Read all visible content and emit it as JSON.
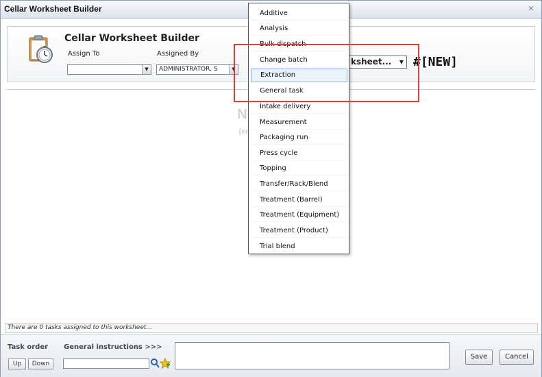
{
  "window": {
    "title": "Cellar Worksheet Builder"
  },
  "header": {
    "title": "Cellar Worksheet Builder",
    "assign_to_label": "Assign To",
    "assign_to_value": "",
    "assigned_by_label": "Assigned By",
    "assigned_by_value": "ADMINISTRATOR, S",
    "worksheet_select_value": "ksheet...",
    "new_label": "#[NEW]"
  },
  "main": {
    "empty_title": "NO TAS          ED",
    "empty_sub_line1": "(select from th                     click",
    "empty_sub_line2": "'Save' to"
  },
  "status": {
    "text": "There are 0 tasks assigned to this worksheet..."
  },
  "footer": {
    "task_order_label": "Task order",
    "general_instructions_label": "General instructions >>>",
    "up_label": "Up",
    "down_label": "Down",
    "save_label": "Save",
    "cancel_label": "Cancel"
  },
  "dropdown": {
    "selected": "Extraction",
    "items": [
      "Additive",
      "Analysis",
      "Bulk dispatch",
      "Change batch",
      "Extraction",
      "General task",
      "Intake delivery",
      "Measurement",
      "Packaging run",
      "Press cycle",
      "Topping",
      "Transfer/Rack/Blend",
      "Treatment (Barrel)",
      "Treatment (Equipment)",
      "Treatment (Product)",
      "Trial blend"
    ]
  },
  "colors": {
    "highlight_box": "#e23b3b",
    "selected_item_bg": "#eaf2fb"
  }
}
